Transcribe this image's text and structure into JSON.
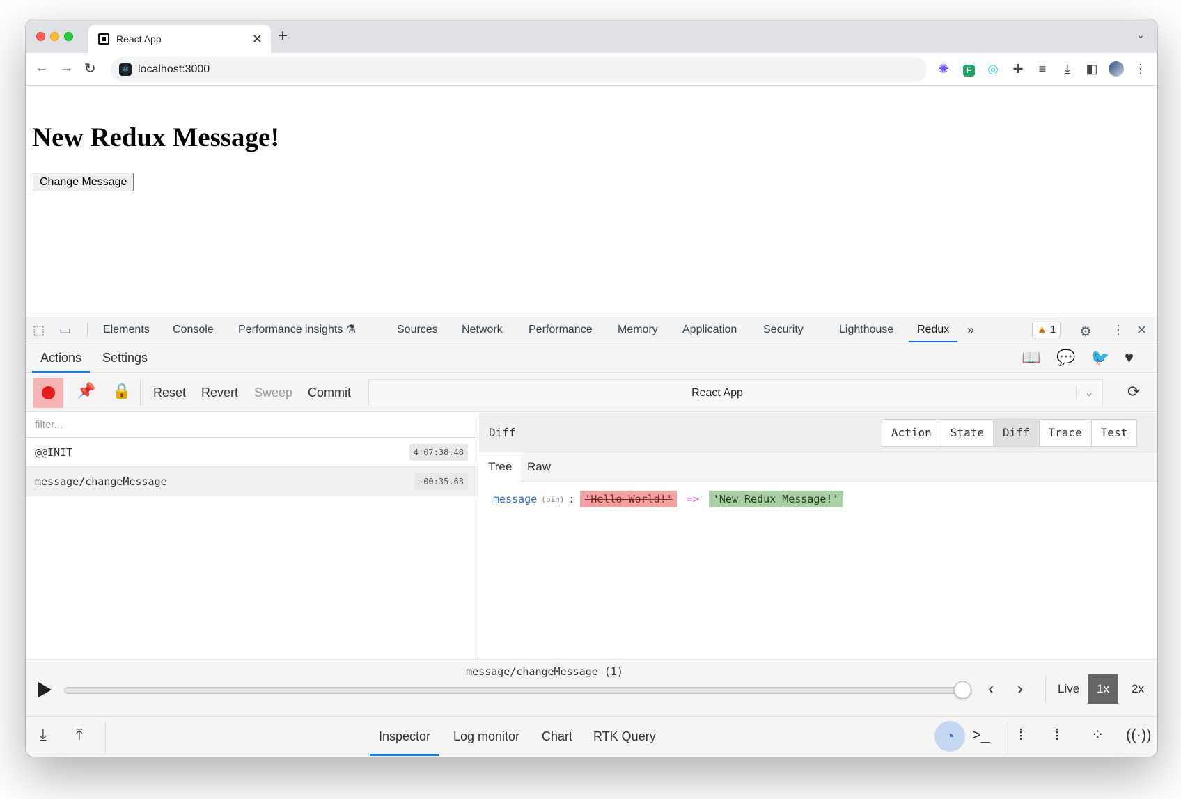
{
  "browser": {
    "tab_title": "React App",
    "new_tab": "+",
    "tab_close": "✕",
    "url": "localhost:3000"
  },
  "page": {
    "heading": "New Redux Message!",
    "button_label": "Change Message"
  },
  "devtools": {
    "tabs": [
      "Elements",
      "Console",
      "Performance insights",
      "Sources",
      "Network",
      "Performance",
      "Memory",
      "Application",
      "Security",
      "Lighthouse",
      "Redux"
    ],
    "active_tab": "Redux",
    "issues_count": "1"
  },
  "redux": {
    "header_tabs": [
      "Actions",
      "Settings"
    ],
    "active_header_tab": "Actions",
    "toolbar": {
      "reset": "Reset",
      "revert": "Revert",
      "sweep": "Sweep",
      "commit": "Commit"
    },
    "instance_name": "React App",
    "filter_placeholder": "filter...",
    "actions": [
      {
        "name": "@@INIT",
        "time": "4:07:38.48"
      },
      {
        "name": "message/changeMessage",
        "time": "+00:35.63"
      }
    ],
    "selected_action": "message/changeMessage",
    "pane_title": "Diff",
    "pane_tabs": [
      "Action",
      "State",
      "Diff",
      "Trace",
      "Test"
    ],
    "active_pane_tab": "Diff",
    "sub_tabs": [
      "Tree",
      "Raw"
    ],
    "active_sub_tab": "Tree",
    "diff": {
      "key": "message",
      "pin": "(pin)",
      "colon": ":",
      "old_value": "'Hello World!'",
      "arrow": "=>",
      "new_value": "'New Redux Message!'"
    },
    "slider": {
      "label": "message/changeMessage (1)",
      "position_fraction": 1.0,
      "speeds": [
        "Live",
        "1x",
        "2x"
      ],
      "active_speed": "1x"
    },
    "monitors": [
      "Inspector",
      "Log monitor",
      "Chart",
      "RTK Query"
    ],
    "active_monitor": "Inspector"
  },
  "colors": {
    "accent": "#1a73e8",
    "record": "#e51a1a",
    "diff_removed": "#f4a0a0",
    "diff_added": "#a9cfa5"
  },
  "icons": [
    "back-arrow-icon",
    "forward-arrow-icon",
    "reload-icon",
    "react-site-icon",
    "inspect-icon",
    "device-icon",
    "flask-icon",
    "more-tabs-icon",
    "warning-icon",
    "gear-icon",
    "kebab-icon",
    "close-icon",
    "book-icon",
    "chat-icon",
    "twitter-icon",
    "heart-icon",
    "record-icon",
    "pin-icon",
    "lock-icon",
    "chevron-down-icon",
    "sync-icon",
    "play-icon",
    "chevron-left-icon",
    "chevron-right-icon",
    "import-icon",
    "export-icon",
    "remote-icon",
    "terminal-icon",
    "dock-left-icon",
    "dock-right-icon",
    "dock-bottom-icon",
    "broadcast-icon"
  ]
}
